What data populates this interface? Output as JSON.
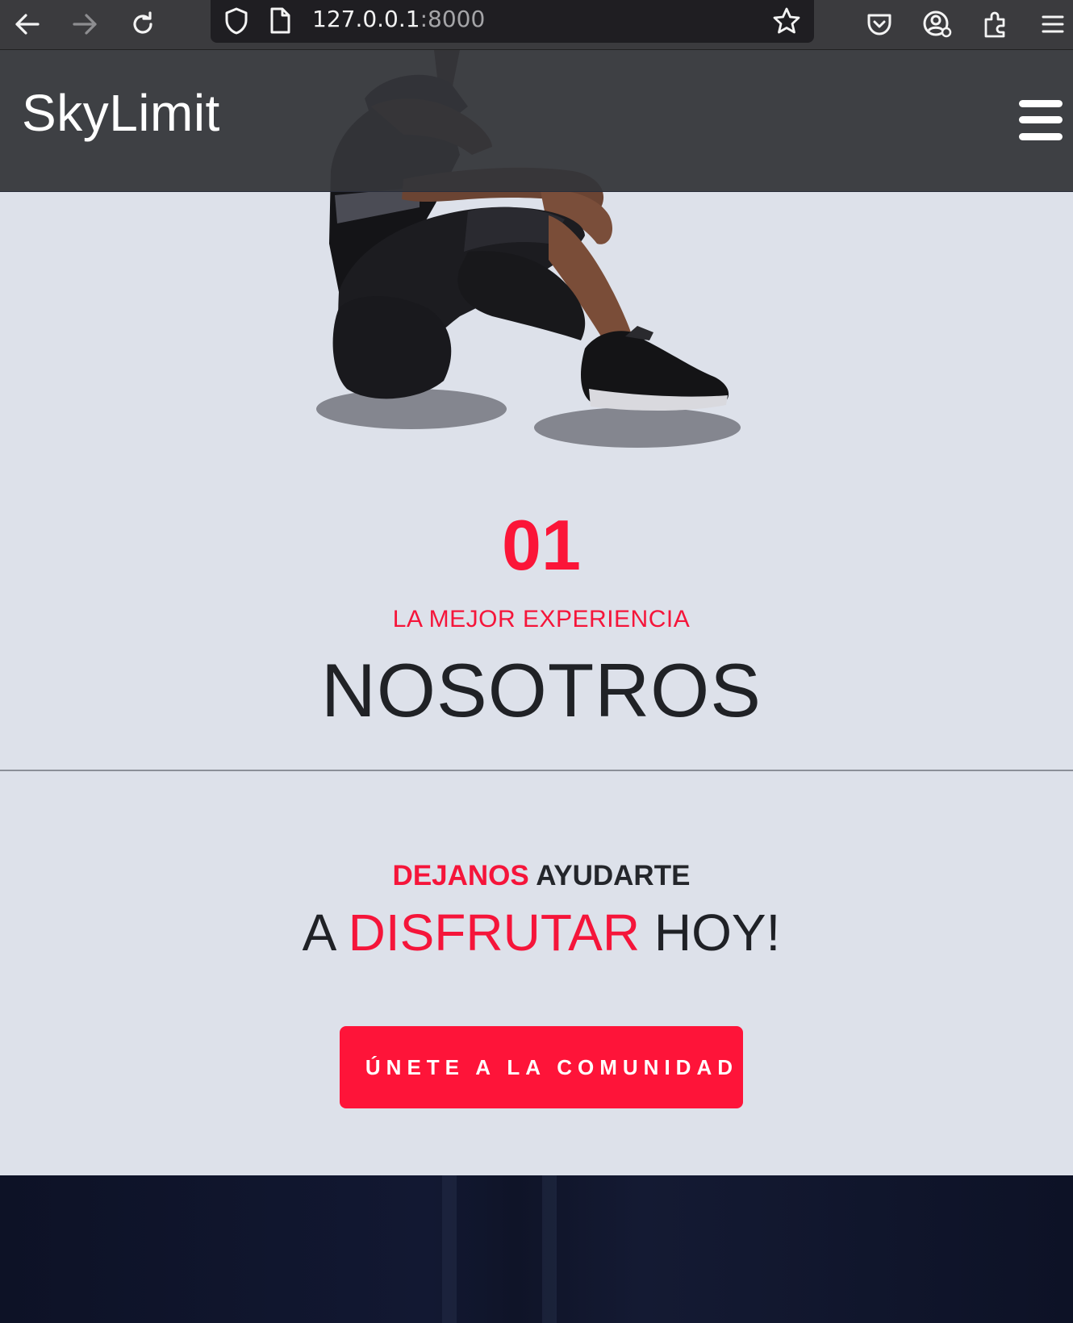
{
  "browser": {
    "url_host": "127.0.0.1",
    "url_port": ":8000"
  },
  "header": {
    "brand": "SkyLimit"
  },
  "hero": {
    "number": "01",
    "eyebrow": "LA MEJOR EXPERIENCIA",
    "title": "NOSOTROS"
  },
  "cta": {
    "line1_red": "DEJANOS",
    "line1_dark": " AYUDARTE",
    "line2_a": "A ",
    "line2_red": "DISFRUTAR",
    "line2_b": " HOY!",
    "button_label": "ÚNETE A LA COMUNIDAD"
  },
  "colors": {
    "accent": "#fb1538",
    "page_bg": "#dde1ea",
    "header_bg": "#343539",
    "footer_bg": "#0d1226"
  },
  "icons": [
    "back-arrow-icon",
    "forward-arrow-icon",
    "reload-icon",
    "shield-icon",
    "page-icon",
    "bookmark-star-icon",
    "pocket-icon",
    "account-icon",
    "extensions-icon",
    "app-menu-icon",
    "hamburger-menu-icon"
  ]
}
